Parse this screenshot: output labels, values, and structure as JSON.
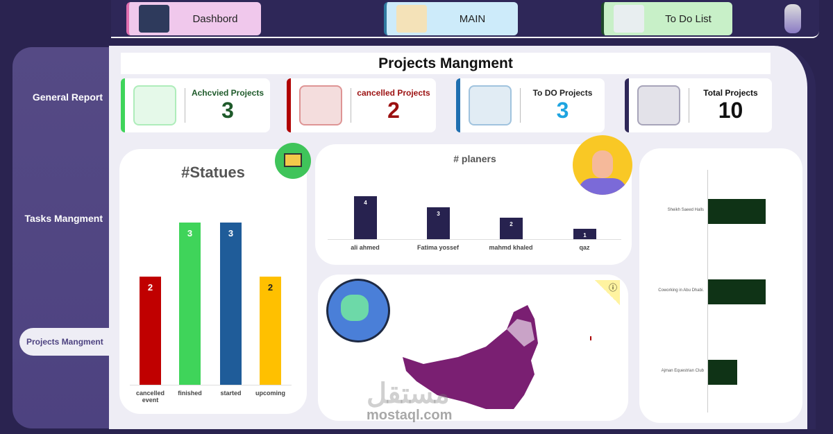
{
  "nav": {
    "buttons": [
      {
        "label": "Dashbord",
        "color": "#f0c8ec",
        "accent": "#e06fb0"
      },
      {
        "label": "MAIN",
        "color": "#cdebfa",
        "accent": "#2f7aa0"
      },
      {
        "label": "To Do List",
        "color": "#c8f0c8",
        "accent": "#1e4a2a"
      }
    ],
    "logo_icon": "calligraphy-logo"
  },
  "sidebar": {
    "items": [
      {
        "label": "General Report"
      },
      {
        "label": "Tasks Mangment"
      },
      {
        "label": "Projects Mangment",
        "active": true
      }
    ]
  },
  "page_title": "Projects Mangment",
  "cards": [
    {
      "label": "Achcvied Projects",
      "value": "3",
      "color": "#1e5a2a",
      "accent": "#3fd45a",
      "icon": "approved-card-icon"
    },
    {
      "label": "cancelled Projects",
      "value": "2",
      "color": "#9b1010",
      "accent": "#b00000",
      "icon": "cancelled-stamp-icon"
    },
    {
      "label": "To DO Projects",
      "value": "3",
      "color": "#1ea4e0",
      "accent": "#1f6fb0",
      "icon": "checklist-icon"
    },
    {
      "label": "Total Projects",
      "value": "10",
      "color": "#111111",
      "accent": "#2e2758",
      "icon": "all-icon"
    }
  ],
  "chart_data": [
    {
      "type": "bar",
      "title": "#Statues",
      "categories": [
        "cancelled event",
        "finished",
        "started",
        "upcoming"
      ],
      "values": [
        2,
        3,
        3,
        2
      ],
      "colors": [
        "#c00000",
        "#3fd45a",
        "#1f5c99",
        "#ffc000"
      ]
    },
    {
      "type": "bar",
      "title": "# planers",
      "categories": [
        "ali ahmed",
        "Fatima yossef",
        "mahmd khaled",
        "qaz"
      ],
      "values": [
        4,
        3,
        2,
        1
      ],
      "color": "#27224f"
    },
    {
      "type": "bar",
      "orientation": "horizontal",
      "title": "",
      "categories": [
        "Sheikh Saeed Halls",
        "Coworking in Abu Dhabi.",
        "Ajman Equestrian Club"
      ],
      "values": [
        2,
        2,
        1
      ],
      "color": "#0f3316"
    }
  ],
  "map": {
    "region": "UAE",
    "color": "#7a1f72",
    "icon": "globe-location-icon",
    "info_icon": "info-icon"
  },
  "watermark": {
    "text": "مستقل",
    "sub": "mostaql.com"
  }
}
